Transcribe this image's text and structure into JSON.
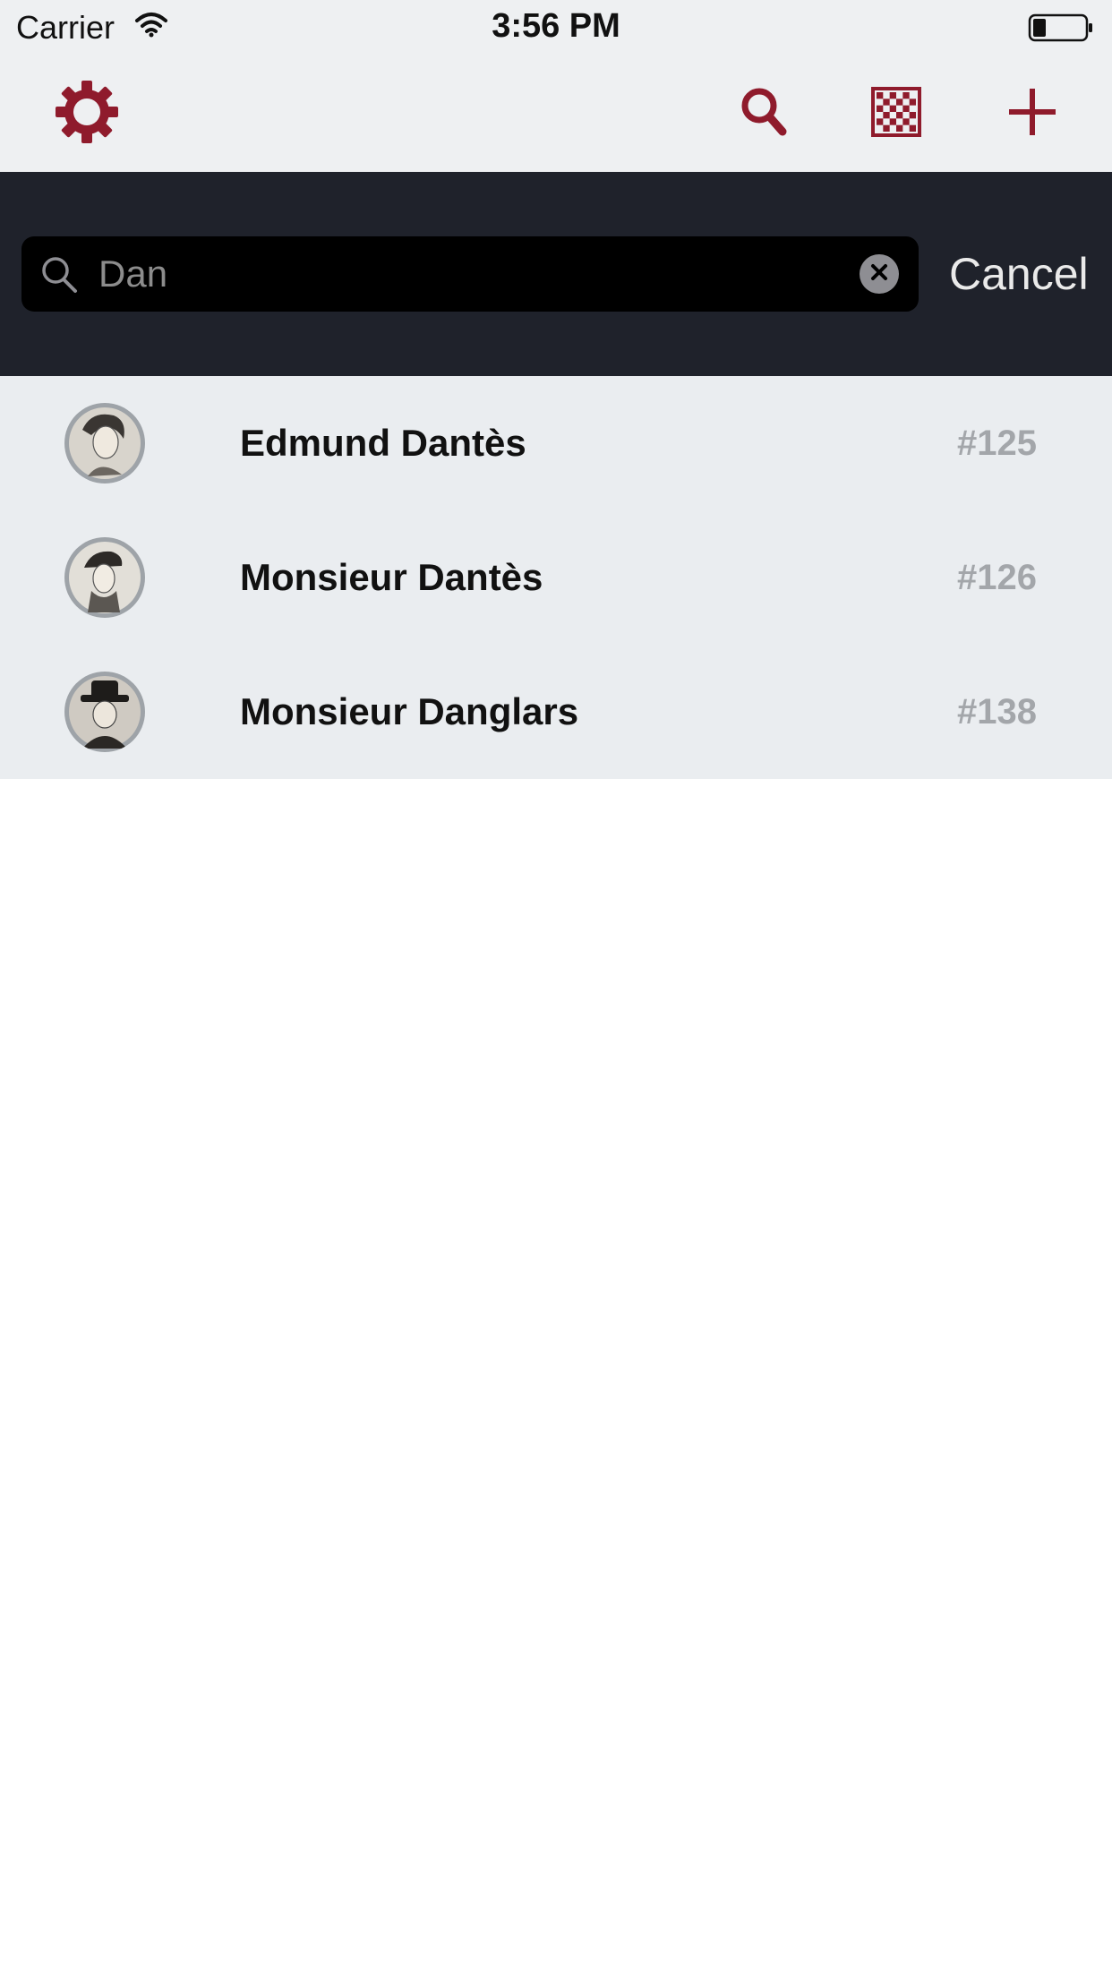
{
  "status_bar": {
    "carrier": "Carrier",
    "time": "3:56 PM"
  },
  "toolbar": {
    "accent_color": "#8f1b2c",
    "buttons": [
      {
        "icon": "gear-icon"
      },
      {
        "icon": "search-icon"
      },
      {
        "icon": "checkerboard-icon"
      },
      {
        "icon": "plus-icon"
      }
    ]
  },
  "search": {
    "value": "Dan",
    "cancel_label": "Cancel"
  },
  "results": [
    {
      "name": "Edmund Dantès",
      "number": "#125"
    },
    {
      "name": "Monsieur Dantès",
      "number": "#126"
    },
    {
      "name": "Monsieur Danglars",
      "number": "#138"
    }
  ]
}
